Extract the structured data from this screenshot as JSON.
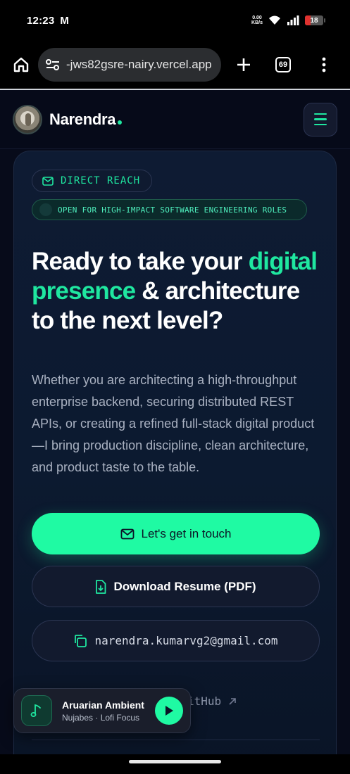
{
  "status_bar": {
    "time": "12:23",
    "carrier_icon": "M",
    "net_speed_value": "0.00",
    "net_speed_unit": "KB/s",
    "battery": "18"
  },
  "browser": {
    "url": "-jws82gsre-nairy.vercel.app",
    "tab_count": "69"
  },
  "header": {
    "brand": "Narendra",
    "accent_color": "#1fe7a0"
  },
  "hero": {
    "badge_label": "DIRECT REACH",
    "status_label": "OPEN FOR HIGH-IMPACT SOFTWARE ENGINEERING ROLES",
    "headline_part1": "Ready to take your ",
    "headline_accent": "digital presence",
    "headline_part2": " & architecture to the next level?",
    "description": "Whether you are architecting a high-throughput enterprise backend, securing distributed REST APIs, or creating a refined full-stack digital product—I bring production discipline, clean architecture, and product taste to the table."
  },
  "actions": {
    "contact_label": "Let's get in touch",
    "resume_label": "Download Resume (PDF)",
    "email": "narendra.kumarvg2@gmail.com",
    "github_label": "itHub"
  },
  "player": {
    "title": "Aruarian Ambient",
    "artist": "Nujabes · Lofi Focus"
  }
}
